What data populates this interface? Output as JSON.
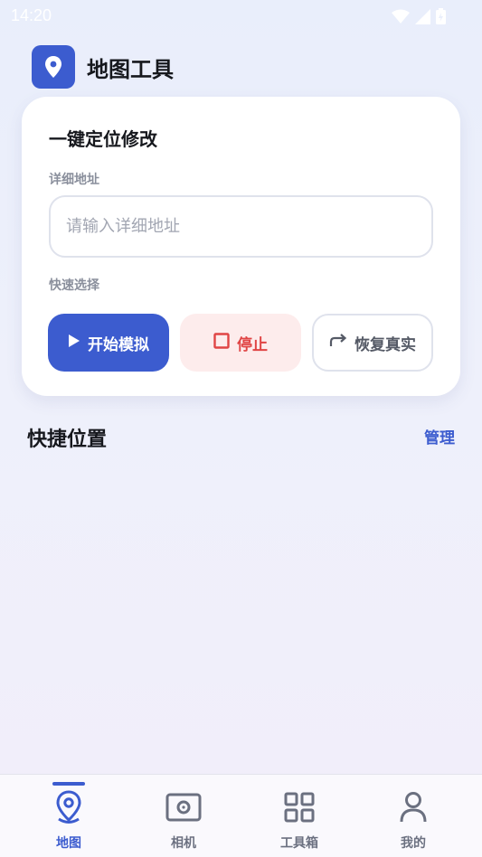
{
  "status_bar": {
    "time": "14:20",
    "icons": [
      "wifi-icon",
      "signal-icon",
      "battery-icon"
    ]
  },
  "header": {
    "title": "地图工具",
    "logo_icon": "location-pin-icon"
  },
  "card": {
    "title": "一键定位修改",
    "address_label": "详细地址",
    "address_placeholder": "请输入详细地址",
    "address_value": "",
    "quick_label": "快速选择",
    "buttons": {
      "start": "开始模拟",
      "stop": "停止",
      "restore": "恢复真实"
    }
  },
  "shortcuts": {
    "title": "快捷位置",
    "manage": "管理"
  },
  "nav": {
    "items": [
      {
        "label": "地图",
        "icon": "map-pin-icon",
        "active": true
      },
      {
        "label": "相机",
        "icon": "camera-icon",
        "active": false
      },
      {
        "label": "工具箱",
        "icon": "grid-icon",
        "active": false
      },
      {
        "label": "我的",
        "icon": "user-icon",
        "active": false
      }
    ]
  },
  "colors": {
    "primary": "#3c5ccf",
    "danger": "#e04444",
    "danger_bg": "#fdecec"
  }
}
